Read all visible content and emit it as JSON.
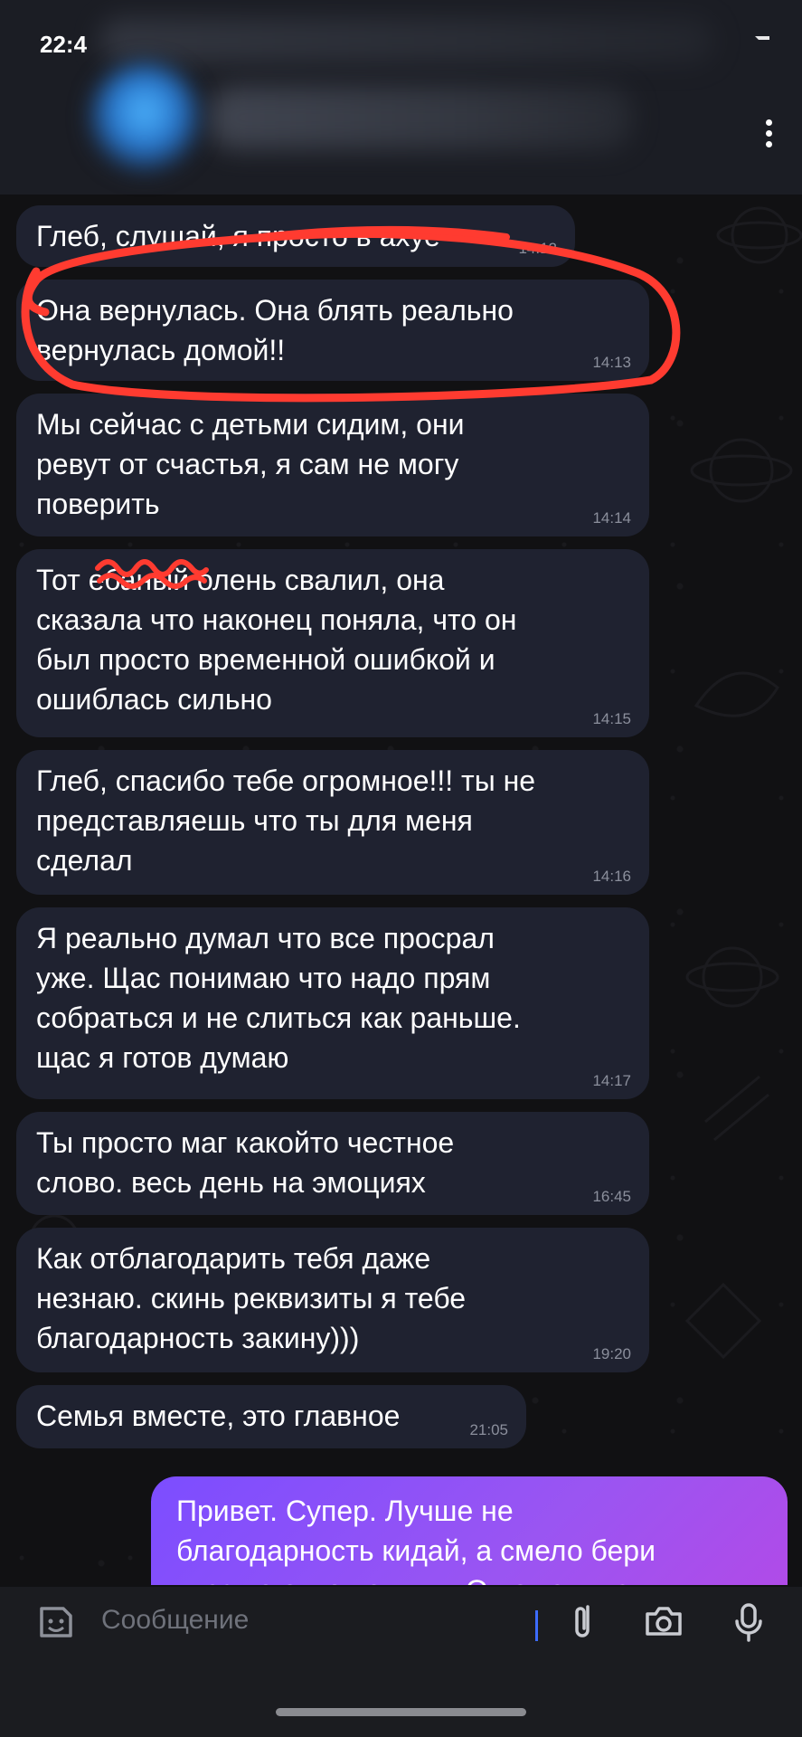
{
  "status_bar": {
    "time": "22:4"
  },
  "composer": {
    "placeholder": "Сообщение"
  },
  "messages": [
    {
      "text": "Глеб, слушай, я просто в ахуе",
      "time": "14:12"
    },
    {
      "text": "Она вернулась. Она блять реально\nвернулась домой!!",
      "time": "14:13"
    },
    {
      "text": "Мы сейчас с детьми сидим, они\nревут от счастья, я сам не могу\nповерить",
      "time": "14:14"
    },
    {
      "text": "Тот ебаный олень свалил, она\nсказала что наконец поняла, что он\nбыл просто временной ошибкой и\nошиблась сильно",
      "time": "14:15"
    },
    {
      "text": "Глеб, спасибо тебе огромное!!! ты не\nпредставляешь что ты для меня\nсделал",
      "time": "14:16"
    },
    {
      "text": "Я реально думал что все просрал\nуже. Щас понимаю что надо прям\nсобраться и не слиться как раньше.\nщас я готов думаю",
      "time": "14:17"
    },
    {
      "text": "Ты просто маг какойто честное\nслово. весь день на эмоциях",
      "time": "16:45"
    },
    {
      "text": "Как отблагодарить тебя даже\nнезнаю. скинь реквизиты я тебе\nблагодарность закину)))",
      "time": "19:20"
    },
    {
      "text": "Семья вместе, это главное",
      "time": "21:05"
    }
  ],
  "outgoing": {
    "text": "Привет. Супер. Лучше не\nблагодарность кидай, а смело бери\nкурс по отношениям. Он о том, как"
  },
  "colors": {
    "incoming_bubble": "#1f2230",
    "outgoing_gradient_start": "#7c4dff",
    "outgoing_gradient_end": "#b04be8",
    "highlight_circle": "#ff3b30"
  },
  "icons": [
    "more-vertical-icon",
    "sticker-icon",
    "attach-icon",
    "camera-icon",
    "microphone-icon"
  ]
}
